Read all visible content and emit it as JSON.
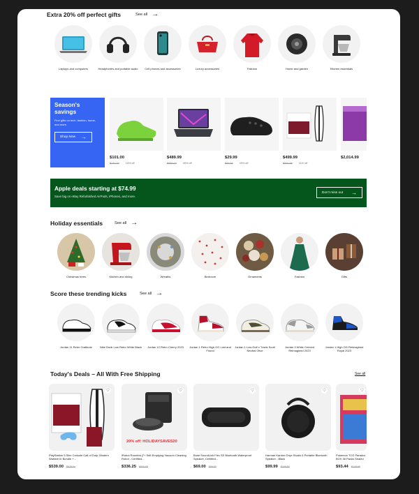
{
  "gifts": {
    "title": "Extra 20% off perfect gifts",
    "see_all": "See all",
    "items": [
      {
        "label": "Laptops and computers"
      },
      {
        "label": "Headphones and portable audio"
      },
      {
        "label": "Cell phones and accessories"
      },
      {
        "label": "Luxury accessories"
      },
      {
        "label": "Fashion"
      },
      {
        "label": "Home and garden"
      },
      {
        "label": "Kitchen essentials"
      }
    ]
  },
  "season": {
    "title": "Season's savings",
    "desc": "Find gifts on tech, fashion, home, and more.",
    "button": "Shop Now",
    "deals": [
      {
        "price": "$101.00",
        "old": "$132.00",
        "off": "15% off"
      },
      {
        "price": "$489.99",
        "old": "$899.00",
        "off": "45% off"
      },
      {
        "price": "$29.99",
        "old": "$59.99",
        "off": "49% off"
      },
      {
        "price": "$499.99",
        "old": "$559.99",
        "off": "11% off"
      },
      {
        "price": "$2,014.99",
        "old": "",
        "off": ""
      }
    ]
  },
  "apple": {
    "title": "Apple deals starting at $74.99",
    "desc": "Save big on eBay Refurbished AirPods, iPhones, and more.",
    "button": "Don't miss out"
  },
  "holiday": {
    "title": "Holiday essentials",
    "see_all": "See all",
    "items": [
      {
        "label": "Christmas trees"
      },
      {
        "label": "Kitchen and dining"
      },
      {
        "label": "Wreaths"
      },
      {
        "label": "Bedroom"
      },
      {
        "label": "Ornaments"
      },
      {
        "label": "Fashion"
      },
      {
        "label": "Gifts"
      }
    ]
  },
  "kicks": {
    "title": "Score these trending kicks",
    "see_all": "See all",
    "items": [
      {
        "label": "Jordan 11 Retro Gratitude"
      },
      {
        "label": "Nike Dunk Low Retro White Black"
      },
      {
        "label": "Jordan 12 Retro Cherry 2023"
      },
      {
        "label": "Jordan 1 Retro High OG Lost and Found"
      },
      {
        "label": "Jordan 1 Low Golf x Travis Scott Neutral Olive"
      },
      {
        "label": "Jordan 3 White Cement Reimagined 2023"
      },
      {
        "label": "Jordan 1 High OG Reimagined Royal 2023"
      }
    ]
  },
  "deals": {
    "title": "Today's Deals – All With Free Shipping",
    "see_all": "See all",
    "items": [
      {
        "title": "PlayStation 5 Slim Console Call of Duty: Modern Warfare III Bundle +...",
        "price": "$539.00",
        "old": "$579.54"
      },
      {
        "title": "iRobot Roomba j7+ Self-Emptying Vacuum Cleaning Robot - Certified...",
        "price": "$336.25",
        "old": "$600.00",
        "tag": "20% off: HOLIDAYSAVES20"
      },
      {
        "title": "Bose SoundLink Flex SE Bluetooth Waterproof Speaker, Certified...",
        "price": "$69.00",
        "old": "$99.00"
      },
      {
        "title": "Harman Kardon Onyx Studio 6 Portable Bluetooth Speaker - Black",
        "price": "$99.99",
        "old": "$169.95"
      },
      {
        "title": "Pokemon TCG Paradox BOX 36 Packs Sealed N...",
        "price": "$93.44",
        "old": "$149.99"
      }
    ]
  }
}
